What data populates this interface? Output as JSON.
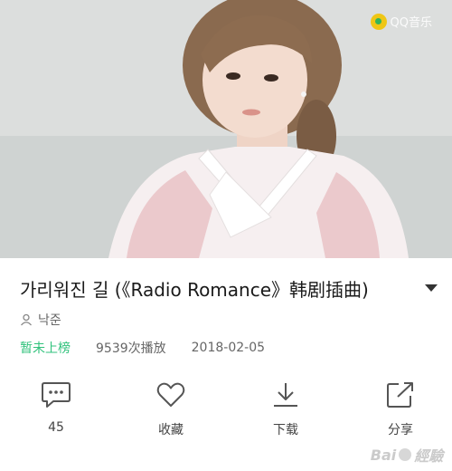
{
  "cover": {
    "brand_logo_text": "QQ音乐"
  },
  "song": {
    "title": "가리워진 길 (《Radio Romance》韩剧插曲)",
    "artist": "낙준",
    "chart_status": "暂未上榜",
    "play_count": "9539次播放",
    "release_date": "2018-02-05"
  },
  "actions": {
    "comment_count": "45",
    "favorite_label": "收藏",
    "download_label": "下载",
    "share_label": "分享"
  },
  "colors": {
    "accent_green": "#31c27c",
    "logo_yellow": "#f2c400"
  },
  "icons": [
    "comment-icon",
    "heart-icon",
    "download-icon",
    "share-icon",
    "person-icon",
    "expand-arrow-icon"
  ]
}
